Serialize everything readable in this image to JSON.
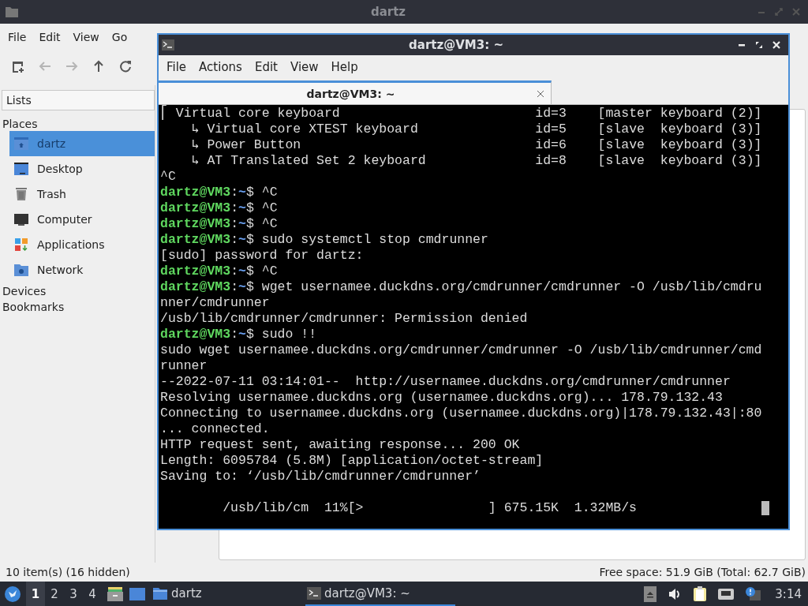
{
  "file_manager": {
    "title": "dartz",
    "menu": [
      "File",
      "Edit",
      "View",
      "Go"
    ],
    "toolbar": [
      {
        "kind": "new-tab",
        "disabled": false
      },
      {
        "kind": "back",
        "disabled": true
      },
      {
        "kind": "forward",
        "disabled": true
      },
      {
        "kind": "up",
        "disabled": false
      },
      {
        "kind": "reload",
        "disabled": false
      }
    ],
    "sidebar": {
      "mode": "Lists",
      "sections": [
        {
          "label": "Places",
          "items": [
            {
              "label": "dartz",
              "kind": "home",
              "selected": true
            },
            {
              "label": "Desktop",
              "kind": "desktop",
              "selected": false
            },
            {
              "label": "Trash",
              "kind": "trash",
              "selected": false
            },
            {
              "label": "Computer",
              "kind": "computer",
              "selected": false
            },
            {
              "label": "Applications",
              "kind": "applications",
              "selected": false
            },
            {
              "label": "Network",
              "kind": "network",
              "selected": false
            }
          ]
        },
        {
          "label": "Devices"
        },
        {
          "label": "Bookmarks"
        }
      ]
    },
    "status_bar": {
      "items": "10 item(s) (16 hidden)",
      "free_space": "Free space: 51.9 GiB (Total: 62.7 GiB)"
    }
  },
  "terminal": {
    "title": "dartz@VM3: ~",
    "menu": [
      "File",
      "Actions",
      "Edit",
      "View",
      "Help"
    ],
    "tabs": [
      {
        "label": "dartz@VM3: ~",
        "selected": true
      }
    ],
    "lines": [
      {
        "kind": "output",
        "text": "⎡ Virtual core keyboard                         id=3    [master keyboard (2)]"
      },
      {
        "kind": "output",
        "text": "    ↳ Virtual core XTEST keyboard               id=5    [slave  keyboard (3)]"
      },
      {
        "kind": "output",
        "text": "    ↳ Power Button                              id=6    [slave  keyboard (3)]"
      },
      {
        "kind": "output",
        "text": "    ↳ AT Translated Set 2 keyboard              id=8    [slave  keyboard (3)]"
      },
      {
        "kind": "output",
        "text": "^C"
      },
      {
        "kind": "prompt",
        "user": "dartz@VM3",
        "sep": ":",
        "path": "~",
        "rest": "$ ^C"
      },
      {
        "kind": "prompt",
        "user": "dartz@VM3",
        "sep": ":",
        "path": "~",
        "rest": "$ ^C"
      },
      {
        "kind": "prompt",
        "user": "dartz@VM3",
        "sep": ":",
        "path": "~",
        "rest": "$ ^C"
      },
      {
        "kind": "prompt",
        "user": "dartz@VM3",
        "sep": ":",
        "path": "~",
        "rest": "$ sudo systemctl stop cmdrunner"
      },
      {
        "kind": "output",
        "text": "[sudo] password for dartz:"
      },
      {
        "kind": "prompt",
        "user": "dartz@VM3",
        "sep": ":",
        "path": "~",
        "rest": "$ ^C"
      },
      {
        "kind": "prompt",
        "user": "dartz@VM3",
        "sep": ":",
        "path": "~",
        "rest": "$ wget usernamee.duckdns.org/cmdrunner/cmdrunner -O /usb/lib/cmdru"
      },
      {
        "kind": "output",
        "text": "nner/cmdrunner"
      },
      {
        "kind": "output",
        "text": "/usb/lib/cmdrunner/cmdrunner: Permission denied"
      },
      {
        "kind": "prompt",
        "user": "dartz@VM3",
        "sep": ":",
        "path": "~",
        "rest": "$ sudo !!"
      },
      {
        "kind": "output",
        "text": "sudo wget usernamee.duckdns.org/cmdrunner/cmdrunner -O /usb/lib/cmdrunner/cmd"
      },
      {
        "kind": "output",
        "text": "runner"
      },
      {
        "kind": "output",
        "text": "--2022-07-11 03:14:01--  http://usernamee.duckdns.org/cmdrunner/cmdrunner"
      },
      {
        "kind": "output",
        "text": "Resolving usernamee.duckdns.org (usernamee.duckdns.org)... 178.79.132.43"
      },
      {
        "kind": "output",
        "text": "Connecting to usernamee.duckdns.org (usernamee.duckdns.org)|178.79.132.43|:80"
      },
      {
        "kind": "output",
        "text": "... connected."
      },
      {
        "kind": "output",
        "text": "HTTP request sent, awaiting response... 200 OK"
      },
      {
        "kind": "output",
        "text": "Length: 6095784 (5.8M) [application/octet-stream]"
      },
      {
        "kind": "output",
        "text": "Saving to: ‘/usb/lib/cmdrunner/cmdrunner’"
      },
      {
        "kind": "blank"
      },
      {
        "kind": "progress",
        "text": "        /usb/lib/cm  11%[>                ] 675.15K  1.32MB/s"
      }
    ]
  },
  "taskbar": {
    "workspaces": [
      {
        "label": "1",
        "selected": true
      },
      {
        "label": "2",
        "selected": false
      },
      {
        "label": "3",
        "selected": false
      },
      {
        "label": "4",
        "selected": false
      }
    ],
    "launchers": [
      {
        "kind": "cabinet"
      },
      {
        "kind": "window"
      }
    ],
    "tasks": [
      {
        "kind": "folder",
        "label": "dartz",
        "selected": false
      },
      {
        "kind": "terminal",
        "label": "dartz@VM3: ~",
        "selected": true
      }
    ],
    "tray": [
      {
        "kind": "eject"
      },
      {
        "kind": "volume"
      },
      {
        "kind": "clipboard"
      },
      {
        "kind": "network"
      },
      {
        "kind": "notification"
      }
    ],
    "clock": "3:14"
  }
}
